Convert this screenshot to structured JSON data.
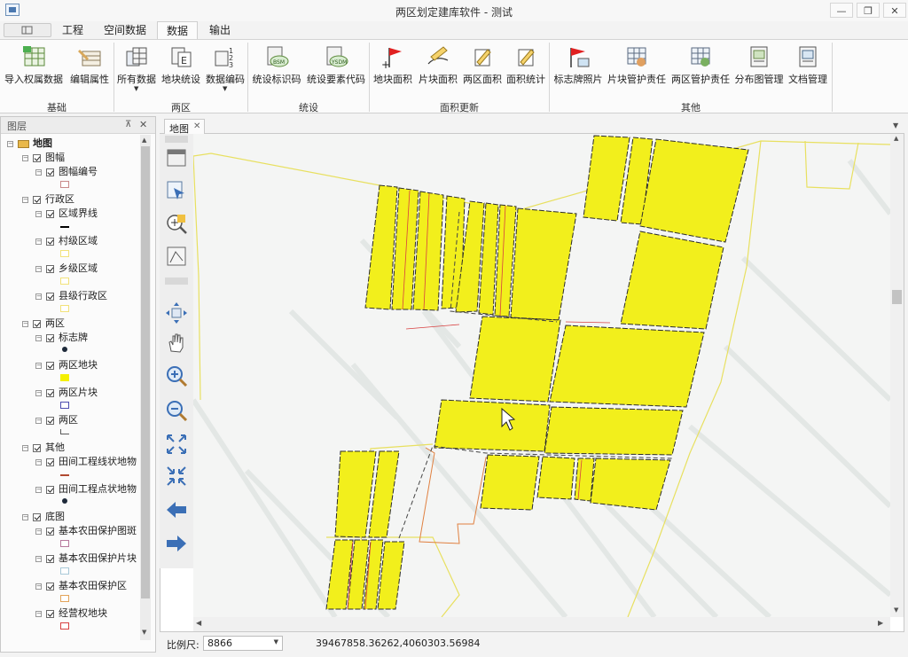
{
  "window": {
    "title": "两区划定建库软件 - 测试",
    "controls": {
      "minimize": "—",
      "restore": "❐",
      "close": "✕"
    }
  },
  "menu_tabs": [
    "工程",
    "空间数据",
    "数据",
    "输出"
  ],
  "active_tab": "数据",
  "ribbon": {
    "groups": [
      {
        "label": "基础",
        "buttons": [
          "导入权属数据",
          "编辑属性"
        ]
      },
      {
        "label": "两区",
        "buttons": [
          "所有数据",
          "地块统设",
          "数据编码"
        ]
      },
      {
        "label": "统设",
        "buttons": [
          "统设标识码",
          "统设要素代码"
        ]
      },
      {
        "label": "面积更新",
        "buttons": [
          "地块面积",
          "片块面积",
          "两区面积",
          "面积统计"
        ]
      },
      {
        "label": "其他",
        "buttons": [
          "标志牌照片",
          "片块管护责任",
          "两区管护责任",
          "分布图管理",
          "文档管理"
        ]
      }
    ],
    "icons": {
      "导入权属数据": "import-table-icon",
      "编辑属性": "edit-attribute-icon",
      "所有数据": "all-data-icon",
      "地块统设": "parcel-setting-icon",
      "数据编码": "data-encode-icon",
      "统设标识码": "bsm-code-icon",
      "统设要素代码": "ysdm-code-icon",
      "地块面积": "parcel-area-flag-icon",
      "片块面积": "block-area-icon",
      "两区面积": "zone-area-icon",
      "面积统计": "area-stats-icon",
      "标志牌照片": "sign-photo-icon",
      "片块管护责任": "block-duty-icon",
      "两区管护责任": "zone-duty-icon",
      "分布图管理": "map-manage-icon",
      "文档管理": "document-manage-icon"
    }
  },
  "layer_panel": {
    "title": "图层",
    "pin": "⊼",
    "close": "✕",
    "tree": [
      {
        "level": 0,
        "label": "地图",
        "bold": true
      },
      {
        "level": 1,
        "label": "图幅"
      },
      {
        "level": 2,
        "label": "图幅编号",
        "swatch": "poly",
        "color": "#c98a8a"
      },
      {
        "level": 1,
        "label": "行政区"
      },
      {
        "level": 2,
        "label": "区域界线",
        "swatch": "dash",
        "color": "#000000"
      },
      {
        "level": 2,
        "label": "村级区域",
        "swatch": "poly",
        "color": "#f2e27a"
      },
      {
        "level": 2,
        "label": "乡级区域",
        "swatch": "poly",
        "color": "#f2e27a"
      },
      {
        "level": 2,
        "label": "县级行政区",
        "swatch": "poly",
        "color": "#f2e27a"
      },
      {
        "level": 1,
        "label": "两区"
      },
      {
        "level": 2,
        "label": "标志牌",
        "swatch": "dot",
        "color": "#1e2a3a"
      },
      {
        "level": 2,
        "label": "两区地块",
        "swatch": "fill",
        "color": "#f4f000"
      },
      {
        "level": 2,
        "label": "两区片块",
        "swatch": "poly",
        "color": "#4d4db0"
      },
      {
        "level": 2,
        "label": "两区",
        "swatch": "bracket",
        "color": "#5a5a5a"
      },
      {
        "level": 1,
        "label": "其他"
      },
      {
        "level": 2,
        "label": "田间工程线状地物",
        "swatch": "line",
        "color": "#b04a30"
      },
      {
        "level": 2,
        "label": "田间工程点状地物",
        "swatch": "dot",
        "color": "#1e2a3a"
      },
      {
        "level": 1,
        "label": "底图"
      },
      {
        "level": 2,
        "label": "基本农田保护图斑",
        "swatch": "poly",
        "color": "#b77a9e"
      },
      {
        "level": 2,
        "label": "基本农田保护片块",
        "swatch": "poly",
        "color": "#a8c9d8"
      },
      {
        "level": 2,
        "label": "基本农田保护区",
        "swatch": "poly",
        "color": "#e3a45a"
      },
      {
        "level": 2,
        "label": "经营权地块",
        "swatch": "poly",
        "color": "#d84040"
      }
    ]
  },
  "map_tab": {
    "label": "地图",
    "close": "✕"
  },
  "map_tools": [
    "full-extent-icon",
    "select-features-icon",
    "identify-icon",
    "measure-icon",
    "pan-center-icon",
    "pan-hand-icon",
    "zoom-in-icon",
    "zoom-out-icon",
    "fixed-zoom-in-icon",
    "fixed-zoom-out-icon",
    "back-arrow-icon",
    "forward-arrow-icon"
  ],
  "status": {
    "scale_label": "比例尺:",
    "scale_value": "8866",
    "coordinates": "39467858.36262,4060303.56984"
  },
  "colors": {
    "parcel_fill": "#f2ef1c",
    "parcel_outline": "#2b2b2b",
    "boundary_yellow": "#e8e060",
    "boundary_orange": "#e08040",
    "ribbon_bg": "#fbfbfb",
    "accent_blue": "#3b6fb6"
  }
}
